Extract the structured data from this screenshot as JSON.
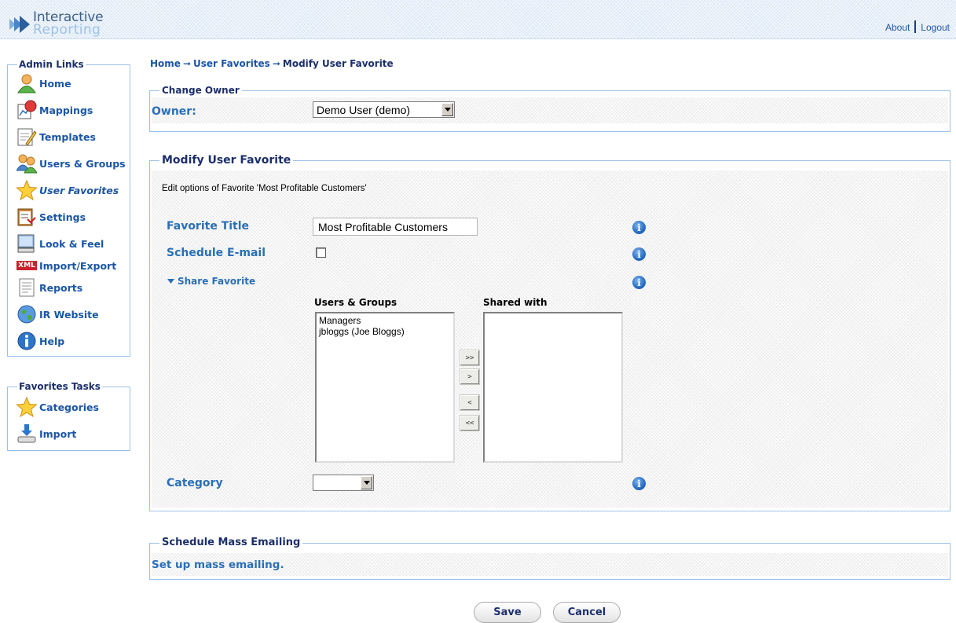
{
  "header": {
    "logo_line1": "Interactive",
    "logo_line2": "Reporting",
    "about_link": "About",
    "logout_link": "Logout"
  },
  "admin_links": {
    "title": "Admin Links",
    "items": [
      {
        "label": "Home",
        "icon": "user-icon"
      },
      {
        "label": "Mappings",
        "icon": "mappings-icon"
      },
      {
        "label": "Templates",
        "icon": "templates-icon"
      },
      {
        "label": "Users & Groups",
        "icon": "users-groups-icon"
      },
      {
        "label": "User Favorites",
        "icon": "star-icon",
        "active": true
      },
      {
        "label": "Settings",
        "icon": "settings-icon"
      },
      {
        "label": "Look & Feel",
        "icon": "monitor-icon"
      },
      {
        "label": "Import/Export",
        "icon": "xml-icon",
        "badge": "XML"
      },
      {
        "label": "Reports",
        "icon": "report-icon"
      },
      {
        "label": "IR Website",
        "icon": "globe-icon"
      },
      {
        "label": "Help",
        "icon": "info-icon"
      }
    ]
  },
  "favorites_tasks": {
    "title": "Favorites Tasks",
    "items": [
      {
        "label": "Categories",
        "icon": "star-icon"
      },
      {
        "label": "Import",
        "icon": "import-icon"
      }
    ]
  },
  "breadcrumb": {
    "home": "Home",
    "user_favorites": "User Favorites",
    "current": "Modify User Favorite"
  },
  "change_owner": {
    "legend": "Change Owner",
    "owner_label": "Owner:",
    "owner_value": "Demo User (demo)"
  },
  "modify_favorite": {
    "legend": "Modify User Favorite",
    "description": "Edit options of Favorite 'Most Profitable Customers'",
    "title_label": "Favorite Title",
    "title_value": "Most Profitable Customers",
    "schedule_label": "Schedule E-mail",
    "schedule_checked": false,
    "share_label": "Share Favorite",
    "users_groups_header": "Users & Groups",
    "shared_with_header": "Shared with",
    "users_groups": [
      "Managers",
      "jbloggs (Joe Bloggs)"
    ],
    "shared_with": [],
    "move_buttons": [
      ">>",
      ">",
      "<",
      "<<"
    ],
    "category_label": "Category",
    "category_value": ""
  },
  "mass_email": {
    "legend": "Schedule Mass Emailing",
    "link": "Set up mass emailing."
  },
  "actions": {
    "save": "Save",
    "cancel": "Cancel"
  },
  "colors": {
    "link_blue": "#1b56a5",
    "heading_navy": "#1c2f6b",
    "label_blue": "#2b6fb6",
    "border_blue": "#9cc1e8"
  }
}
